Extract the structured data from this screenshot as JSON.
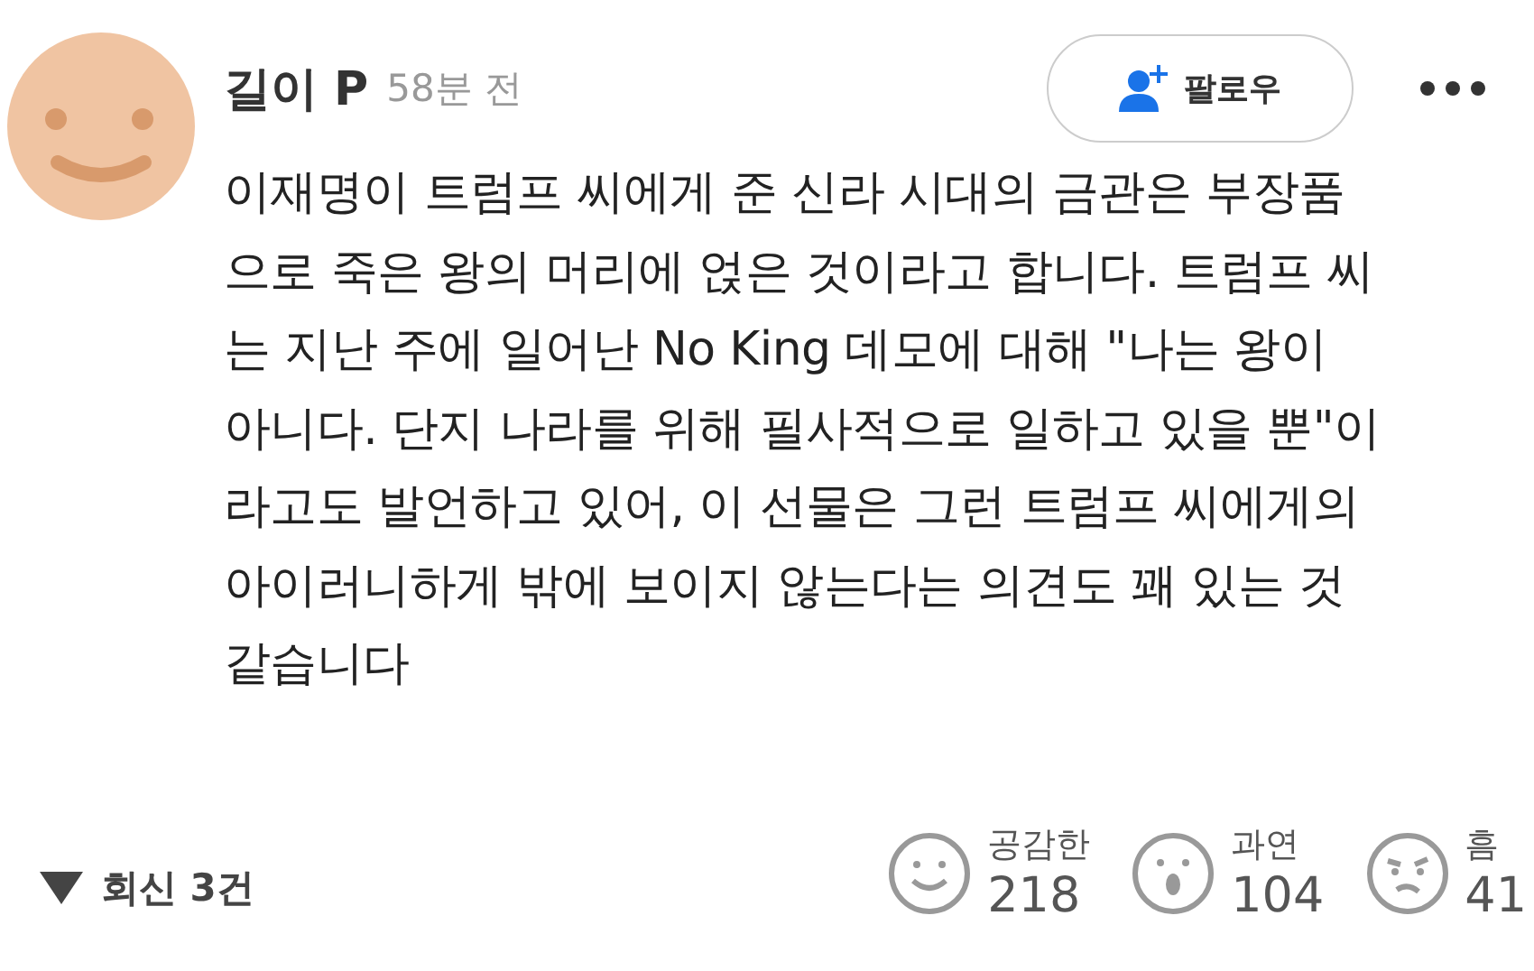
{
  "comment": {
    "author": "길이 P",
    "time": "58분 전",
    "body_lines": [
      "이재명이 트럼프 씨에게 준 신라 시대의 금관은 부장품",
      "으로 죽은 왕의 머리에 얹은 것이라고 합니다. 트럼프 씨",
      "는 지난 주에 일어난 No King 데모에 대해 \"나는 왕이",
      "아니다. 단지 나라를 위해 필사적으로 일하고 있을 뿐\"이",
      "라고도 발언하고 있어, 이 선물은 그런 트럼프 씨에게의",
      "아이러니하게 밖에 보이지 않는다는 의견도 꽤 있는 것",
      "같습니다"
    ]
  },
  "follow_button": {
    "label": "팔로우"
  },
  "replies": {
    "label": "회신 3건",
    "expanded": false
  },
  "reactions": [
    {
      "kind": "smile",
      "label": "공감한",
      "count": "218"
    },
    {
      "kind": "surprised",
      "label": "과연",
      "count": "104"
    },
    {
      "kind": "confused",
      "label": "흠",
      "count": "41"
    }
  ]
}
